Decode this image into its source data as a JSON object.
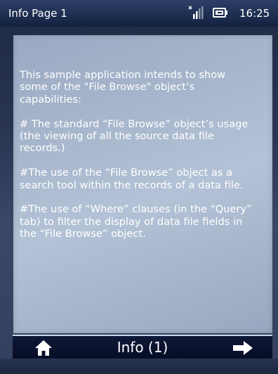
{
  "status_bar": {
    "title": "Info Page 1",
    "time": "16:25",
    "icons": [
      "signal-icon",
      "battery-icon"
    ]
  },
  "content": {
    "paragraphs": [
      "This sample application intends to show\nsome of the \"File Browse\" object’s\ncapabilities:",
      "# The standard “File Browse” object’s usage\n(the viewing of all the source data file\nrecords.)",
      "#The use of the “File Browse” object as a\nsearch tool within the records of a data file.",
      "#The use of “Where” clauses (in the “Query”\ntab) to filter the display of data file fields in\nthe “File Browse” object."
    ]
  },
  "bottom_bar": {
    "label": "Info (1)",
    "icons": [
      "home-icon",
      "arrow-right-icon"
    ]
  },
  "colors": {
    "status_bar": "#1d2d4f",
    "panel": "#a7b6cc",
    "bottom_bar": "#0e1838",
    "text": "#ffffff"
  }
}
